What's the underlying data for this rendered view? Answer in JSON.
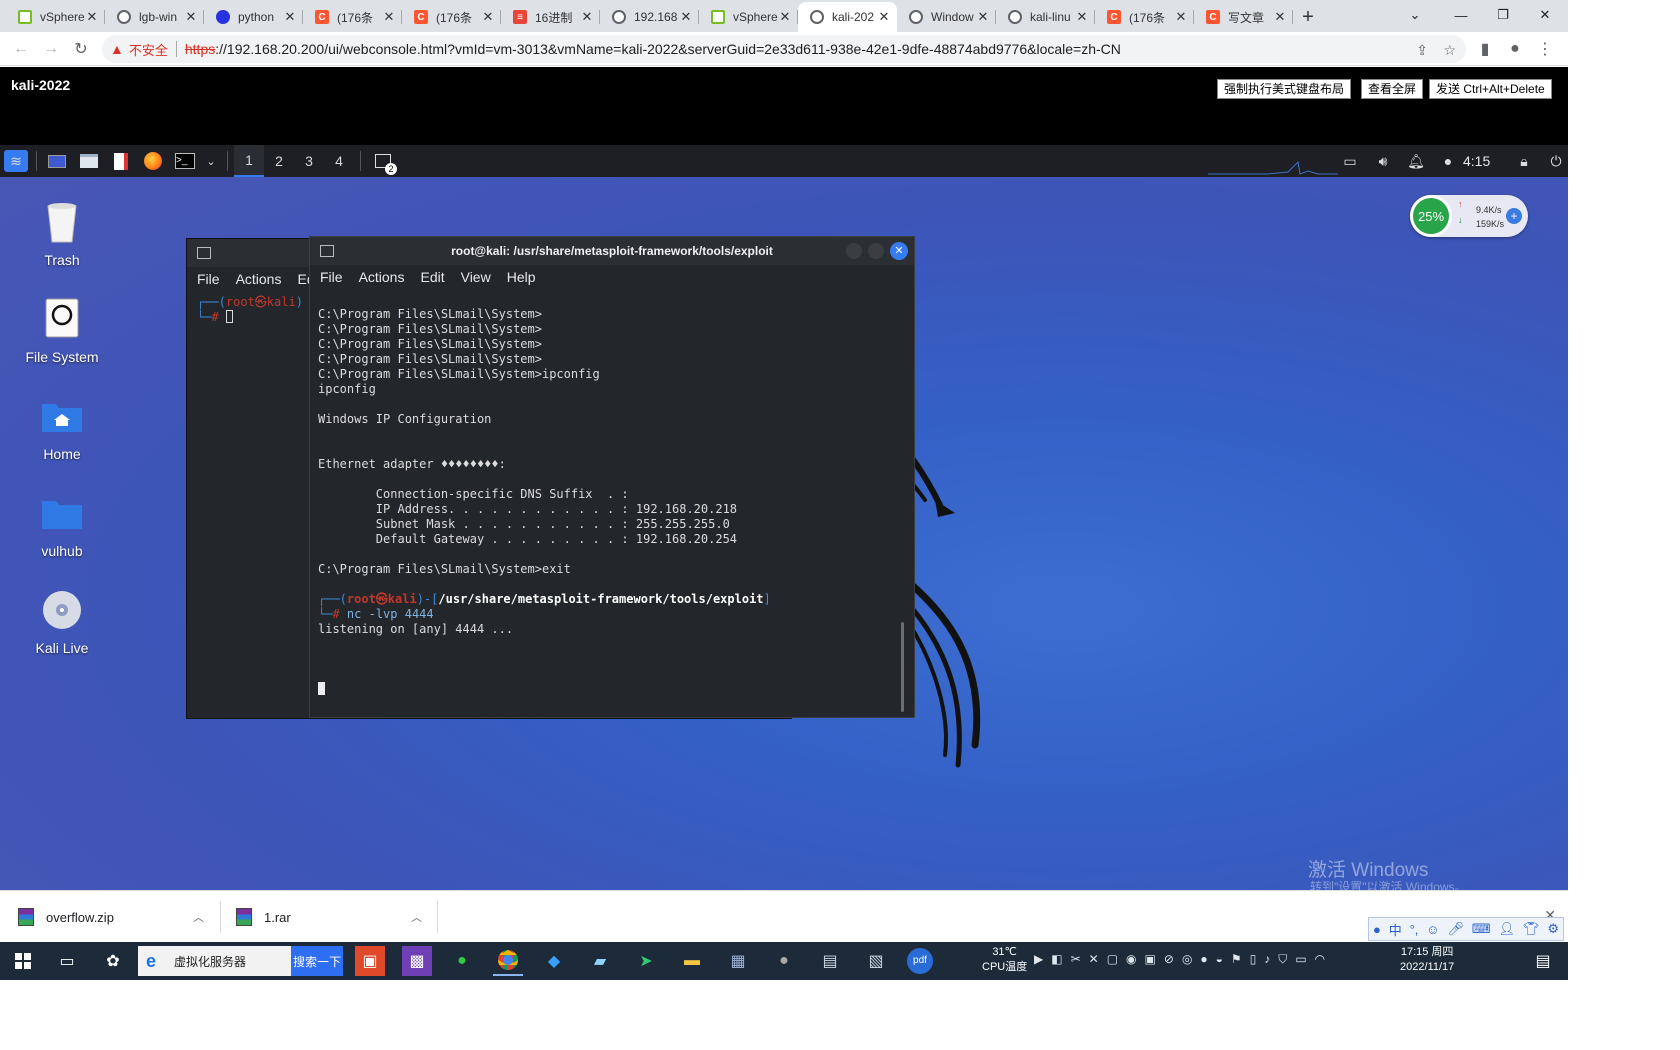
{
  "browser": {
    "tabs": [
      {
        "title": "vSphere",
        "fav": "vsphere",
        "active": false
      },
      {
        "title": "lgb-win",
        "fav": "globe",
        "active": false
      },
      {
        "title": "python",
        "fav": "baidu",
        "active": false
      },
      {
        "title": "(176条",
        "fav": "csdn",
        "active": false
      },
      {
        "title": "(176条",
        "fav": "csdn",
        "active": false
      },
      {
        "title": "16进制",
        "fav": "hex",
        "active": false
      },
      {
        "title": "192.168",
        "fav": "globe",
        "active": false
      },
      {
        "title": "vSphere",
        "fav": "vsphere",
        "active": false
      },
      {
        "title": "kali-202",
        "fav": "globe",
        "active": true
      },
      {
        "title": "Window",
        "fav": "globe",
        "active": false
      },
      {
        "title": "kali-linu",
        "fav": "globe",
        "active": false
      },
      {
        "title": "(176条",
        "fav": "csdn",
        "active": false
      },
      {
        "title": "写文章",
        "fav": "csdn",
        "active": false
      }
    ],
    "security_label": "不安全",
    "url_scheme": "https",
    "url_rest": "://192.168.20.200/ui/webconsole.html?vmId=vm-3013&vmName=kali-2022&serverGuid=2e33d611-938e-42e1-9dfe-48874abd9776&locale=zh-CN"
  },
  "vm": {
    "name": "kali-2022",
    "buttons": {
      "force_keyboard": "强制执行美式键盘布局",
      "fullscreen": "查看全屏",
      "send_cad": "发送 Ctrl+Alt+Delete"
    }
  },
  "kali_panel": {
    "workspaces": [
      "1",
      "2",
      "3",
      "4"
    ],
    "active_workspace": "1",
    "badge": "2",
    "clock": "4:15"
  },
  "desktop_icons": [
    {
      "label": "Trash",
      "icon": "trash-icon"
    },
    {
      "label": "File System",
      "icon": "drive-icon"
    },
    {
      "label": "Home",
      "icon": "home-folder-icon"
    },
    {
      "label": "vulhub",
      "icon": "folder-icon"
    },
    {
      "label": "Kali Live",
      "icon": "disc-icon"
    }
  ],
  "net_widget": {
    "percent": "25%",
    "up": "9.4K/s",
    "down": "159K/s"
  },
  "terminal_back": {
    "menu": [
      "File",
      "Actions",
      "Ed"
    ],
    "prompt_user": "root㉿kali",
    "prompt_hash": "#"
  },
  "terminal_front": {
    "title": "root@kali: /usr/share/metasploit-framework/tools/exploit",
    "menu": [
      "File",
      "Actions",
      "Edit",
      "View",
      "Help"
    ],
    "lines": [
      "C:\\Program Files\\SLmail\\System>",
      "C:\\Program Files\\SLmail\\System>",
      "C:\\Program Files\\SLmail\\System>",
      "C:\\Program Files\\SLmail\\System>",
      "C:\\Program Files\\SLmail\\System>ipconfig",
      "ipconfig",
      "",
      "Windows IP Configuration",
      "",
      "",
      "Ethernet adapter ♦♦♦♦♦♦♦♦:",
      "",
      "        Connection-specific DNS Suffix  . :",
      "        IP Address. . . . . . . . . . . . : 192.168.20.218",
      "        Subnet Mask . . . . . . . . . . . : 255.255.255.0",
      "        Default Gateway . . . . . . . . . : 192.168.20.254",
      "",
      "C:\\Program Files\\SLmail\\System>exit",
      ""
    ],
    "prompt_user": "root㉿kali",
    "prompt_path": "/usr/share/metasploit-framework/tools/exploit",
    "command": "nc -lvp 4444",
    "output": "listening on [any] 4444 ..."
  },
  "watermark": {
    "line1": "激活 Windows",
    "line2": "转到\"设置\"以激活 Windows。"
  },
  "downloads": [
    {
      "name": "overflow.zip"
    },
    {
      "name": "1.rar"
    }
  ],
  "taskbar": {
    "search_text": "虚拟化服务器",
    "search_button": "搜索一下",
    "temp": "31℃",
    "temp_label": "CPU温度",
    "time": "17:15 周四",
    "date": "2022/11/17"
  }
}
